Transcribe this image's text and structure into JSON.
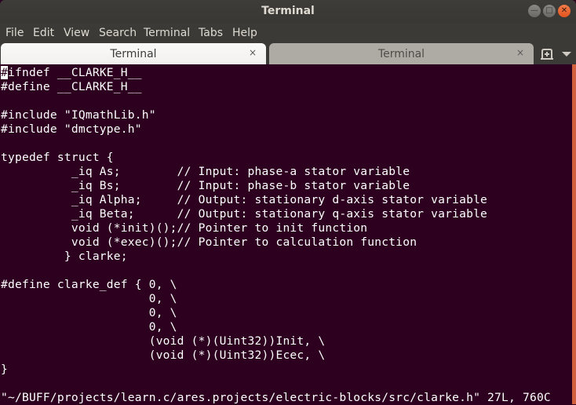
{
  "window": {
    "title": "Terminal",
    "minimize_icon": "minimize-icon",
    "maximize_icon": "maximize-icon",
    "close_icon": "close-icon"
  },
  "menubar": {
    "items": [
      "File",
      "Edit",
      "View",
      "Search",
      "Terminal",
      "Tabs",
      "Help"
    ]
  },
  "tabs": [
    {
      "label": "Terminal",
      "active": true,
      "close": "×"
    },
    {
      "label": "Terminal",
      "active": false,
      "close": "×"
    }
  ],
  "toolbar": {
    "new_tab_icon": "new-tab-icon",
    "tab_menu_icon": "chevron-down-icon"
  },
  "terminal": {
    "cursor_char": "#",
    "first_line_rest": "ifndef __CLARKE_H__",
    "lines": [
      "#define __CLARKE_H__",
      "",
      "#include \"IQmathLib.h\"",
      "#include \"dmctype.h\"",
      "",
      "typedef struct {",
      "          _iq As;        // Input: phase-a stator variable",
      "          _iq Bs;        // Input: phase-b stator variable",
      "          _iq Alpha;     // Output: stationary d-axis stator variable",
      "          _iq Beta;      // Output: stationary q-axis stator variable",
      "          void (*init)();// Pointer to init function",
      "          void (*exec)();// Pointer to calculation function",
      "         } clarke;",
      "",
      "#define clarke_def { 0, \\",
      "                     0, \\",
      "                     0, \\",
      "                     0, \\",
      "                     (void (*)(Uint32))Init, \\",
      "                     (void (*)(Uint32))Ecec, \\",
      "}"
    ],
    "status_line": "\"~/BUFF/projects/learn.c/ares.projects/electric-blocks/src/clarke.h\" 27L, 760C"
  },
  "colors": {
    "terminal_bg": "#2c001e",
    "scrollbar": "#d1603d",
    "close_button": "#e95420"
  }
}
